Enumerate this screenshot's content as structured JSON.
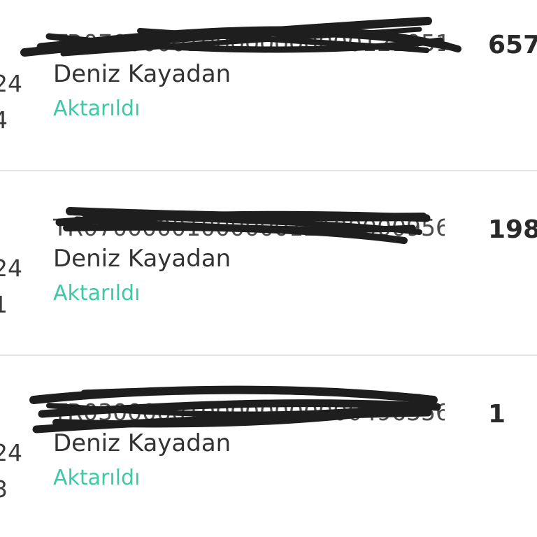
{
  "transactions": [
    {
      "date_line1": "24",
      "date_line2": "4",
      "iban": "TR0700000100000000000121951356",
      "name": "Deniz Kayadan",
      "status": "Aktarıldı",
      "amount": "657"
    },
    {
      "date_line1": "24",
      "date_line2": "1",
      "iban": "TR0700000100000012100000956356",
      "name": "Deniz Kayadan",
      "status": "Aktarıldı",
      "amount": "198"
    },
    {
      "date_line1": "24",
      "date_line2": "3",
      "iban": "TR0300000100000000000496356",
      "name": "Deniz Kayadan",
      "status": "Aktarıldı",
      "amount": "1"
    }
  ],
  "colors": {
    "status": "#3cc9a6",
    "divider": "#e4e4e4",
    "redaction": "#1e1e1e"
  }
}
